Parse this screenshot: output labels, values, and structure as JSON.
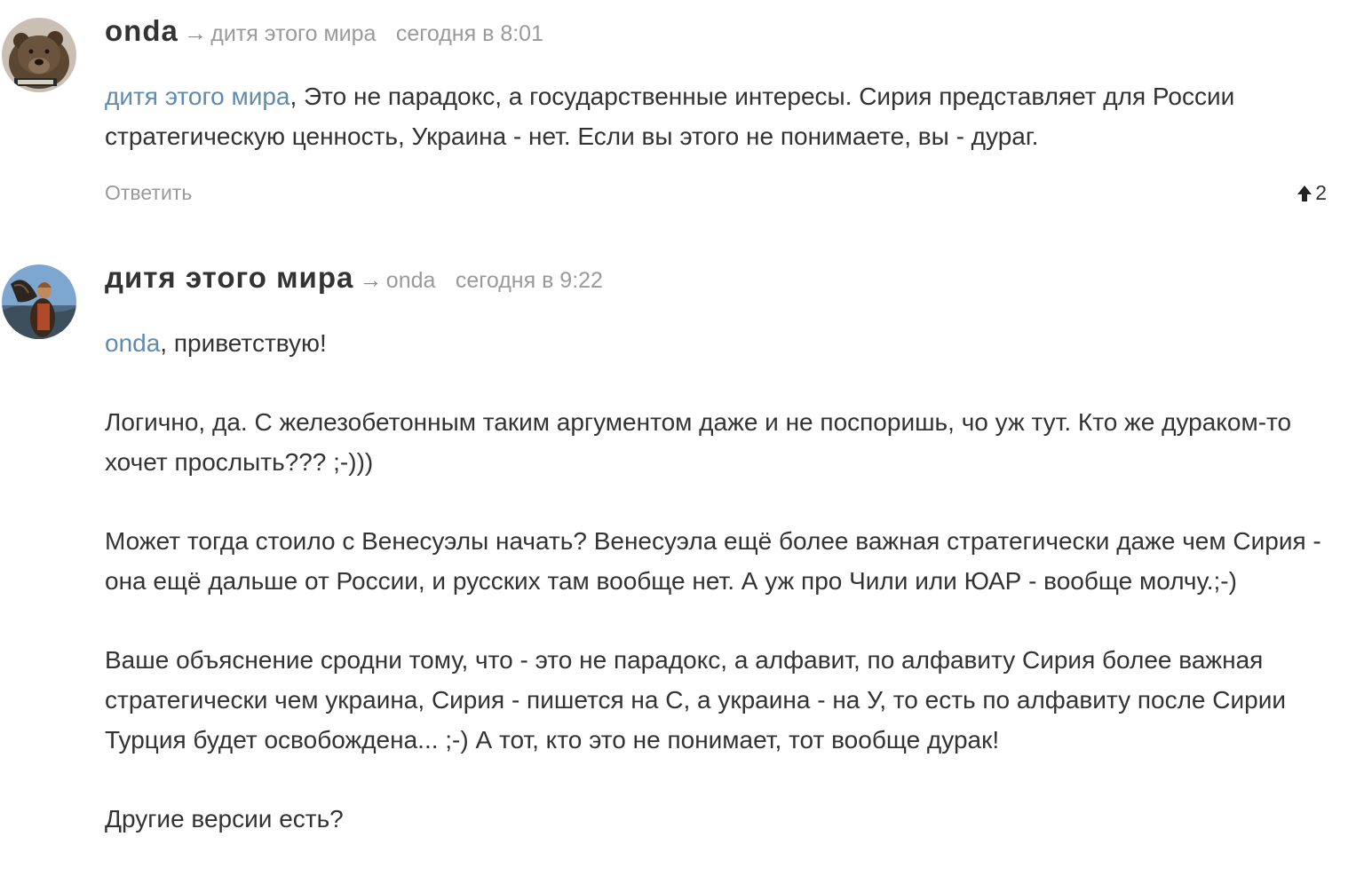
{
  "comments": [
    {
      "author": "onda",
      "reply_arrow": "→",
      "reply_to": "дитя этого мира",
      "time": "сегодня в 8:01",
      "mention": "дитя этого мира",
      "paragraph_1_rest": ", Это не парадокс, а государственные интересы. Сирия представляет для России стратегическую ценность, Украина - нет. Если вы этого не понимаете, вы - дураг.",
      "reply_label": "Ответить",
      "votes": "2",
      "avatar_icon": "bear-avatar-icon"
    },
    {
      "author": "дитя этого мира",
      "reply_arrow": "→",
      "reply_to": "onda",
      "time": "сегодня в 9:22",
      "mention": "onda",
      "paragraph_1_rest": ", приветствую!",
      "paragraphs": [
        "Логично, да. С железобетонным таким аргументом даже и не поспоришь, чо уж тут. Кто же дураком-то хочет прослыть??? ;-)))",
        "Может тогда стоило с Венесуэлы начать? Венесуэла ещё более важная стратегически даже чем Сирия - она ещё дальше от России, и русских там вообще нет. А уж про Чили или ЮАР - вообще молчу.;-)",
        "Ваше объяснение сродни тому, что - это не парадокс, а алфавит, по алфавиту Сирия более важная стратегически чем украина, Сирия - пишется на С, а украина - на У, то есть по алфавиту после Сирии Турция будет освобождена...    ;-) А тот, кто это не понимает, тот вообще дурак!",
        "Другие версии есть?"
      ],
      "avatar_icon": "falconer-avatar-icon"
    }
  ],
  "colors": {
    "mention": "#5f8bb0",
    "meta": "#9a9a9a",
    "text": "#333333"
  }
}
